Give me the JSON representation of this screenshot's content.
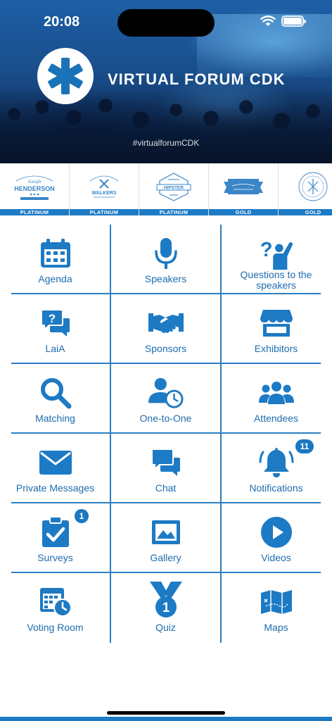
{
  "status_bar": {
    "time": "20:08"
  },
  "header": {
    "title": "VIRTUAL FORUM CDK",
    "hashtag": "#virtualforumCDK",
    "logo_icon": "asterisk-icon"
  },
  "sponsors": [
    {
      "name_lines": [
        "Joseph",
        "HENDERSON"
      ],
      "tier": "PLATINUM"
    },
    {
      "name_lines": [
        "WALKERS"
      ],
      "tier": "PLATINUM"
    },
    {
      "name_lines": [
        "HIPSTER"
      ],
      "tier": "PLATINUM"
    },
    {
      "name_lines": [],
      "tier": "GOLD"
    },
    {
      "name_lines": [],
      "tier": "GOLD"
    }
  ],
  "menu": {
    "agenda": "Agenda",
    "speakers": "Speakers",
    "questions": "Questions to the speakers",
    "laia": "LaiA",
    "sponsors": "Sponsors",
    "exhibitors": "Exhibitors",
    "matching": "Matching",
    "one_to_one": "One-to-One",
    "attendees": "Attendees",
    "private_messages": "Private Messages",
    "chat": "Chat",
    "notifications": "Notifications",
    "notifications_badge": "11",
    "surveys": "Surveys",
    "surveys_badge": "1",
    "gallery": "Gallery",
    "videos": "Videos",
    "voting_room": "Voting Room",
    "quiz": "Quiz",
    "maps": "Maps"
  },
  "colors": {
    "accent": "#1d7ac4",
    "label": "#1e6cae"
  }
}
